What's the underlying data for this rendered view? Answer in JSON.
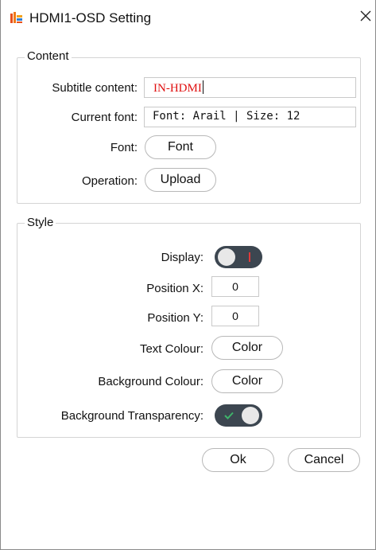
{
  "window": {
    "title": "HDMI1-OSD Setting",
    "icon": "app-logo-icon",
    "close_icon": "close-icon"
  },
  "content": {
    "legend": "Content",
    "subtitle_label": "Subtitle content:",
    "subtitle_value": "IN-HDMI",
    "current_font_label": "Current font:",
    "current_font_value": "Font: Arail | Size: 12",
    "font_label": "Font:",
    "font_button": "Font",
    "operation_label": "Operation:",
    "upload_button": "Upload"
  },
  "style": {
    "legend": "Style",
    "display_label": "Display:",
    "display_on": false,
    "position_x_label": "Position X:",
    "position_x_value": "0",
    "position_y_label": "Position Y:",
    "position_y_value": "0",
    "text_colour_label": "Text Colour:",
    "text_colour_button": "Color",
    "background_colour_label": "Background Colour:",
    "background_colour_button": "Color",
    "background_transparency_label": "Background Transparency:",
    "background_transparency_on": true
  },
  "footer": {
    "ok_button": "Ok",
    "cancel_button": "Cancel"
  },
  "colors": {
    "toggle_track": "#3c4650",
    "subtitle_text": "#e01010",
    "toggle_check": "#3fb36a",
    "toggle_off_mark": "#e03a3a"
  }
}
